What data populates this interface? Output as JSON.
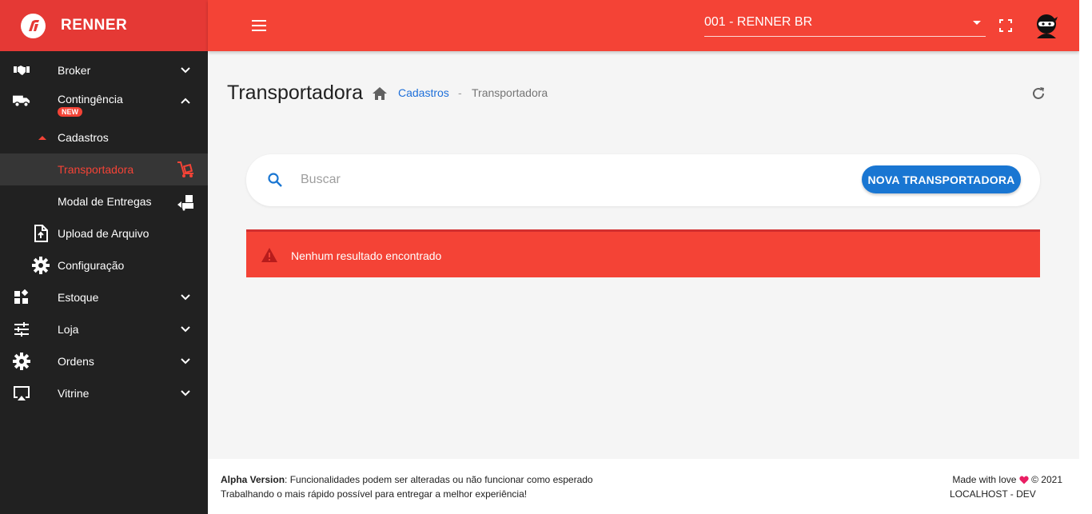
{
  "brand": {
    "title": "RENNER"
  },
  "topbar": {
    "store_select": "001 - RENNER BR"
  },
  "sidebar": {
    "items": [
      {
        "label": "Broker"
      },
      {
        "label": "Contingência",
        "badge": "NEW"
      },
      {
        "label": "Cadastros"
      },
      {
        "label": "Transportadora"
      },
      {
        "label": "Modal de Entregas"
      },
      {
        "label": "Upload de Arquivo"
      },
      {
        "label": "Configuração"
      },
      {
        "label": "Estoque"
      },
      {
        "label": "Loja"
      },
      {
        "label": "Ordens"
      },
      {
        "label": "Vitrine"
      }
    ]
  },
  "page": {
    "title": "Transportadora",
    "breadcrumb": {
      "link": "Cadastros",
      "separator": "-",
      "current": "Transportadora"
    }
  },
  "search": {
    "placeholder": "Buscar",
    "new_button": "NOVA TRANSPORTADORA"
  },
  "alert": {
    "text": "Nenhum resultado encontrado"
  },
  "footer": {
    "alpha_label": "Alpha Version",
    "alpha_text": ": Funcionalidades podem ser alteradas ou não funcionar como esperado",
    "line2": "Trabalhando o mais rápido possível para entregar a melhor experiência!",
    "made_with": "Made with love",
    "copyright": "© 2021",
    "env": "LOCALHOST - DEV"
  },
  "colors": {
    "primary_red": "#f44336",
    "brand_red": "#e53935",
    "accent_blue": "#1976d2",
    "sidebar_bg": "#212121",
    "heart": "#e91e63"
  }
}
